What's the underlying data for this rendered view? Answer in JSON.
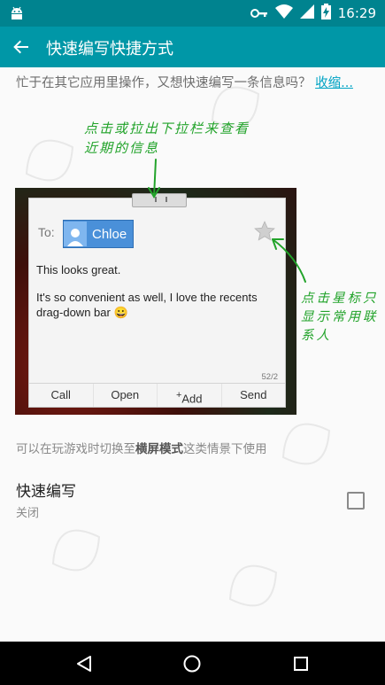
{
  "status_bar": {
    "time": "16:29",
    "icons": [
      "android-debug-icon",
      "key-icon",
      "wifi-icon",
      "signal-icon",
      "battery-charging-icon"
    ]
  },
  "app_bar": {
    "title": "快速编写快捷方式",
    "back_icon": "arrow-back-icon"
  },
  "intro": {
    "text": "忙于在其它应用里操作，又想快速编写一条信息吗？",
    "link": "收缩..."
  },
  "annotations": {
    "top": "点击或拉出下拉栏来查看近期的信息",
    "right": "点击星标只显示常用联系人"
  },
  "demo": {
    "to_label": "To:",
    "contact_name": "Chloe",
    "message_line1": "This looks great.",
    "message_line2": "It's so convenient as well, I love the recents drag-down bar",
    "emoji": "😀",
    "counter": "52/2",
    "actions": [
      "Call",
      "Open",
      "Add",
      "Send"
    ],
    "add_prefix": "+"
  },
  "note": {
    "before": "可以在玩游戏时切换至",
    "highlight": "横屏模式",
    "after": "这类情景下使用"
  },
  "setting": {
    "title": "快速编写",
    "summary": "关闭",
    "checked": false
  },
  "nav_bar": {
    "icons": [
      "back-triangle-icon",
      "home-circle-icon",
      "recents-square-icon"
    ]
  },
  "colors": {
    "status_bar": "#00838f",
    "app_bar": "#0097a7",
    "link": "#00a3c4",
    "annotation": "#22a32a",
    "chip": "#4a90d9"
  }
}
